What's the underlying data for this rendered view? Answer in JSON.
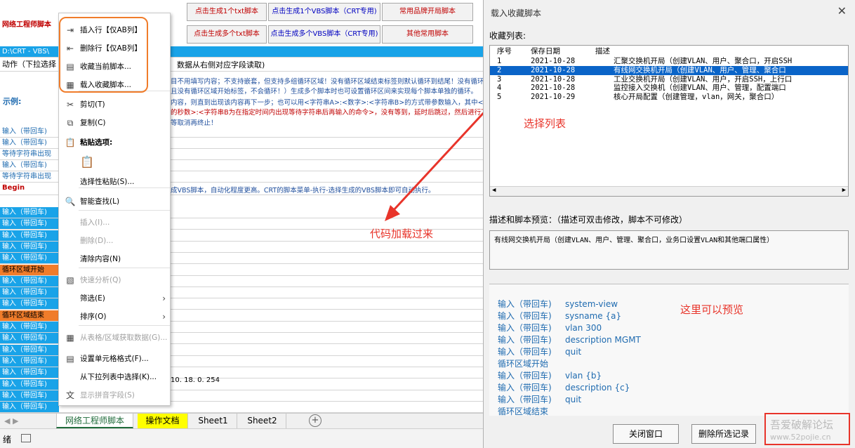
{
  "sheet": {
    "title_cell": "网络工程师脚本",
    "path_cell": "D:\\CRT - VBS\\",
    "action_cell": "动作（下拉选择",
    "example_label": "示例:",
    "header_hint": "数据从右侧对应字段读取)",
    "top_buttons": [
      "点击生成1个txt脚本",
      "点击生成1个VBS脚本（CRT专用)",
      "常用品牌开局脚本",
      "点击生成多个txt脚本",
      "点击生成多个VBS脚本（CRT专用)",
      "其他常用脚本"
    ],
    "notes": [
      "目不用填写内容；不支持嵌套，但支持多组循环区域！没有循环区域结束标签则默认循环到结尾！没有循环区域",
      "且没有循环区域开始标签，不会循环！）生成多个脚本时也可设置循环区间来实现每个脚本单独的循环。",
      "内容，则直到出现该内容再下一步；也可以用<字符串A>:<数字>:<字符串B>的方式带参数输入，其中<字符串",
      "的秒数>:<字符串B为在指定时间内出现等待字符串后再输入的命令>，没有等到，延时后跳过，然后进行下一",
      "等取消再终止！"
    ],
    "vbs_note": "成VBS脚本，自动化程度更高。CRT的脚本菜单-执行-选择生成的VBS脚本即可自动执行。",
    "ip_text": "10. 18. 0. 254",
    "rows_top": [
      "输入（带回车)",
      "输入（带回车)",
      "等待字符串出现",
      "输入（带回车)",
      "等待字符串出现",
      "Begin"
    ],
    "rows_blue": [
      {
        "text": "输入（带回车)",
        "style": "blue"
      },
      {
        "text": "输入（带回车)",
        "style": "blue"
      },
      {
        "text": "输入（带回车)",
        "style": "blue"
      },
      {
        "text": "输入（带回车)",
        "style": "blue"
      },
      {
        "text": "输入（带回车)",
        "style": "blue"
      },
      {
        "text": "循环区域开始",
        "style": "orange"
      },
      {
        "text": "输入（带回车)",
        "style": "blue"
      },
      {
        "text": "输入（带回车)",
        "style": "blue"
      },
      {
        "text": "输入（带回车)",
        "style": "blue"
      },
      {
        "text": "循环区域结束",
        "style": "orange"
      },
      {
        "text": "输入（带回车)",
        "style": "blue"
      },
      {
        "text": "输入（带回车)",
        "style": "blue"
      },
      {
        "text": "输入（带回车)",
        "style": "blue"
      },
      {
        "text": "输入（带回车)",
        "style": "blue"
      },
      {
        "text": "输入（带回车)",
        "style": "blue"
      },
      {
        "text": "输入（带回车)",
        "style": "blue"
      },
      {
        "text": "输入（带回车)",
        "style": "blue"
      },
      {
        "text": "输入（带回车)",
        "style": "blue"
      }
    ]
  },
  "context_menu": {
    "items": [
      {
        "label": "插入行【仅AB列】",
        "icon": "insert-row-icon",
        "state": "normal"
      },
      {
        "label": "删除行【仅AB列】",
        "icon": "delete-row-icon",
        "state": "normal"
      },
      {
        "label": "收藏当前脚本...",
        "icon": "favorite-icon",
        "state": "normal"
      },
      {
        "label": "载入收藏脚本...",
        "icon": "load-icon",
        "state": "normal"
      },
      {
        "label": "剪切(T)",
        "icon": "scissors-icon",
        "state": "normal"
      },
      {
        "label": "复制(C)",
        "icon": "copy-icon",
        "state": "normal"
      },
      {
        "label": "粘贴选项:",
        "icon": "paste-icon",
        "state": "bold"
      },
      {
        "label": "",
        "icon": "paste-clipboard-icon",
        "state": "normal"
      },
      {
        "label": "选择性粘贴(S)...",
        "icon": "",
        "state": "normal"
      },
      {
        "label": "智能查找(L)",
        "icon": "smart-lookup-icon",
        "state": "normal"
      },
      {
        "label": "插入(I)...",
        "icon": "",
        "state": "disabled"
      },
      {
        "label": "删除(D)...",
        "icon": "",
        "state": "disabled"
      },
      {
        "label": "清除内容(N)",
        "icon": "",
        "state": "normal"
      },
      {
        "label": "快速分析(Q)",
        "icon": "quick-analysis-icon",
        "state": "disabled"
      },
      {
        "label": "筛选(E)",
        "icon": "",
        "state": "normal",
        "submenu": true
      },
      {
        "label": "排序(O)",
        "icon": "",
        "state": "normal",
        "submenu": true
      },
      {
        "label": "从表格/区域获取数据(G)...",
        "icon": "table-icon",
        "state": "disabled"
      },
      {
        "label": "设置单元格格式(F)...",
        "icon": "format-cells-icon",
        "state": "normal"
      },
      {
        "label": "从下拉列表中选择(K)...",
        "icon": "",
        "state": "normal"
      },
      {
        "label": "显示拼音字段(S)",
        "icon": "phonetic-icon",
        "state": "disabled"
      }
    ]
  },
  "tabs": [
    {
      "label": "网络工程师脚本",
      "active": true
    },
    {
      "label": "操作文档",
      "highlight": true
    },
    {
      "label": "Sheet1"
    },
    {
      "label": "Sheet2"
    }
  ],
  "dialog": {
    "title": "载入收藏脚本",
    "list_label": "收藏列表:",
    "columns": [
      "序号",
      "保存日期",
      "描述"
    ],
    "rows": [
      {
        "no": "1",
        "date": "2021-10-28",
        "desc": "汇聚交换机开局（创建VLAN、用户、聚合口，开启SSH",
        "selected": false
      },
      {
        "no": "2",
        "date": "2021-10-28",
        "desc": "有线网交换机开局（创建VLAN、用户、管理、聚合口",
        "selected": true
      },
      {
        "no": "3",
        "date": "2021-10-28",
        "desc": "工业交换机开局（创建VLAN、用户，开启SSH，上行口",
        "selected": false
      },
      {
        "no": "4",
        "date": "2021-10-28",
        "desc": "监控接入交换机（创建VLAN、用户、管理，配置端口",
        "selected": false
      },
      {
        "no": "5",
        "date": "2021-10-29",
        "desc": "核心开局配置（创建管理，vlan，网关，聚合口）",
        "selected": false
      }
    ],
    "preview_label": "描述和脚本预览：（描述可双击修改，脚本不可修改）",
    "description": "有线网交换机开局（创建VLAN、用户、管理、聚合口，业务口设置VLAN和其他端口属性）",
    "script": [
      {
        "action": "输入（带回车)",
        "value": "system-view"
      },
      {
        "action": "输入（带回车)",
        "value": "sysname {a}"
      },
      {
        "action": "输入（带回车)",
        "value": "vlan 300"
      },
      {
        "action": "输入（带回车)",
        "value": "description MGMT"
      },
      {
        "action": "输入（带回车)",
        "value": "quit"
      },
      {
        "action": "循环区域开始",
        "value": ""
      },
      {
        "action": "输入（带回车)",
        "value": "vlan {b}"
      },
      {
        "action": "输入（带回车)",
        "value": "description {c}"
      },
      {
        "action": "输入（带回车)",
        "value": "quit"
      },
      {
        "action": "循环区域结束",
        "value": ""
      }
    ],
    "close_button": "关闭窗口",
    "delete_button": "删除所选记录"
  },
  "annotations": {
    "select_list": "选择列表",
    "code_loaded": "代码加载过来",
    "preview_here": "这里可以预览"
  },
  "watermark": {
    "line1": "吾爱破解论坛",
    "line2": "www.52pojie.cn"
  },
  "colors": {
    "annotation": "#e8342a",
    "selection": "#0a64c8",
    "cell_blue": "#19a3e8",
    "cell_orange": "#f07c2a"
  }
}
